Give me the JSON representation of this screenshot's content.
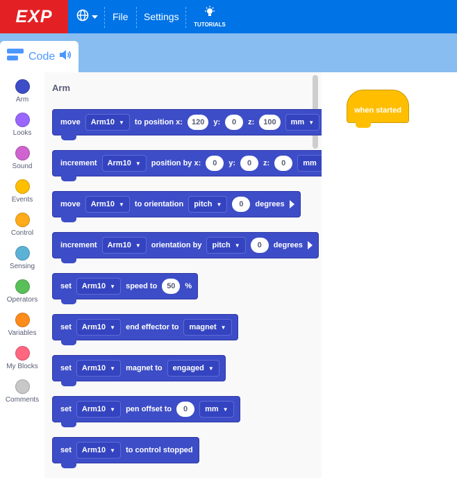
{
  "menubar": {
    "logo": "EXP",
    "file": "File",
    "settings": "Settings",
    "tutorials": "TUTORIALS"
  },
  "tabs": {
    "code": "Code"
  },
  "categories": [
    {
      "label": "Arm",
      "color": "#3d4dc7"
    },
    {
      "label": "Looks",
      "color": "#9966ff"
    },
    {
      "label": "Sound",
      "color": "#cf63cf"
    },
    {
      "label": "Events",
      "color": "#ffbf00"
    },
    {
      "label": "Control",
      "color": "#ffab19"
    },
    {
      "label": "Sensing",
      "color": "#5cb1d6"
    },
    {
      "label": "Operators",
      "color": "#59c059"
    },
    {
      "label": "Variables",
      "color": "#ff8c1a"
    },
    {
      "label": "My Blocks",
      "color": "#ff6680"
    },
    {
      "label": "Comments",
      "color": "#c8c8c8"
    }
  ],
  "flyout": {
    "title": "Arm",
    "blocks": [
      {
        "op": "move",
        "arm": "Arm10",
        "t1": "to position x:",
        "x": "120",
        "ly": "y:",
        "y": "0",
        "lz": "z:",
        "z": "100",
        "unit": "mm"
      },
      {
        "op": "increment",
        "arm": "Arm10",
        "t1": "position by x:",
        "x": "0",
        "ly": "y:",
        "y": "0",
        "lz": "z:",
        "z": "0",
        "unit": "mm"
      },
      {
        "op": "move",
        "arm": "Arm10",
        "t1": "to orientation",
        "axis": "pitch",
        "val": "0",
        "t2": "degrees"
      },
      {
        "op": "increment",
        "arm": "Arm10",
        "t1": "orientation by",
        "axis": "pitch",
        "val": "0",
        "t2": "degrees"
      },
      {
        "op": "set",
        "arm": "Arm10",
        "t1": "speed to",
        "val": "50",
        "t2": "%"
      },
      {
        "op": "set",
        "arm": "Arm10",
        "t1": "end effector to",
        "opt": "magnet"
      },
      {
        "op": "set",
        "arm": "Arm10",
        "t1": "magnet to",
        "opt": "engaged"
      },
      {
        "op": "set",
        "arm": "Arm10",
        "t1": "pen offset to",
        "val": "0",
        "opt": "mm"
      },
      {
        "op": "set",
        "arm": "Arm10",
        "t1": "to control stopped"
      }
    ]
  },
  "script": {
    "hat_label": "when started"
  },
  "colors": {
    "menubar": "#0073e6",
    "logo_bg": "#e32124",
    "arm_block": "#3d4dc7",
    "event_block": "#ffbf00",
    "tab_strip": "#87bdf0"
  }
}
